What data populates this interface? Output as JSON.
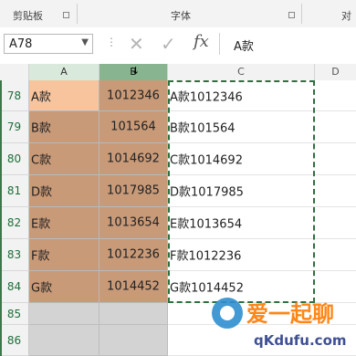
{
  "ribbon": {
    "groups": [
      {
        "label": "剪贴板"
      },
      {
        "label": "字体"
      },
      {
        "label": "对"
      }
    ]
  },
  "formula_bar": {
    "name_box": "A78",
    "cancel_glyph": "✕",
    "enter_glyph": "✓",
    "fx_label": "fx",
    "formula_value": "A款"
  },
  "columns": [
    {
      "id": "A",
      "label": "A"
    },
    {
      "id": "B",
      "label": "B"
    },
    {
      "id": "C",
      "label": "C"
    },
    {
      "id": "D",
      "label": "D"
    }
  ],
  "column_marker": "↓",
  "rows": [
    {
      "row": "78",
      "a": "A款",
      "b": "1012346",
      "c": "A款1012346"
    },
    {
      "row": "79",
      "a": "B款",
      "b": "101564",
      "c": "B款101564"
    },
    {
      "row": "80",
      "a": "C款",
      "b": "1014692",
      "c": "C款1014692"
    },
    {
      "row": "81",
      "a": "D款",
      "b": "1017985",
      "c": "D款1017985"
    },
    {
      "row": "82",
      "a": "E款",
      "b": "1013654",
      "c": "E款1013654"
    },
    {
      "row": "83",
      "a": "F款",
      "b": "1012236",
      "c": "F款1012236"
    },
    {
      "row": "84",
      "a": "G款",
      "b": "1014452",
      "c": "G款1014452"
    },
    {
      "row": "85",
      "a": "",
      "b": "",
      "c": ""
    },
    {
      "row": "86",
      "a": "",
      "b": "",
      "c": ""
    }
  ],
  "watermark": {
    "line1": "爱一起聊",
    "line2": "qKdufu.com"
  },
  "colors": {
    "highlight_fill": "#c99a78",
    "first_cell_fill": "#f7c49d",
    "selection_green": "#2e7040"
  }
}
